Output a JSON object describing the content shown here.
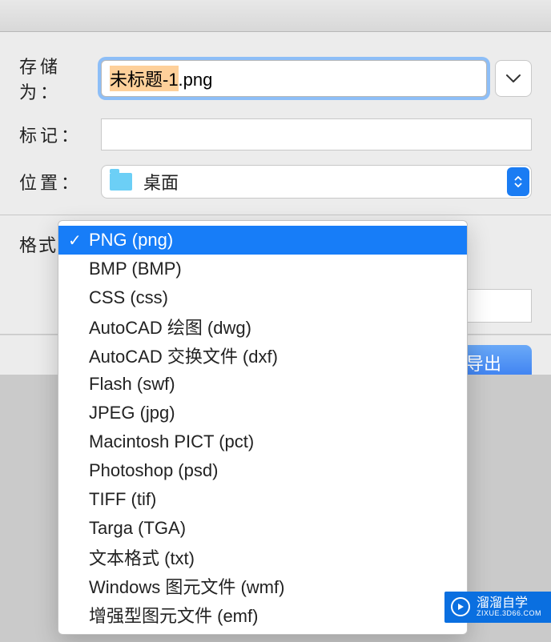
{
  "titlebar": {},
  "fields": {
    "saveas_label": "存储为：",
    "saveas_value": "未标题-1.png",
    "tags_label": "标记：",
    "tags_value": "",
    "location_label": "位置：",
    "location_value": "桌面",
    "format_label": "格式"
  },
  "format_menu": {
    "selected_index": 0,
    "items": [
      "PNG (png)",
      "BMP (BMP)",
      "CSS (css)",
      "AutoCAD 绘图 (dwg)",
      "AutoCAD 交换文件 (dxf)",
      "Flash (swf)",
      "JPEG (jpg)",
      "Macintosh PICT (pct)",
      "Photoshop (psd)",
      "TIFF (tif)",
      "Targa (TGA)",
      "文本格式 (txt)",
      "Windows 图元文件 (wmf)",
      "增强型图元文件 (emf)"
    ]
  },
  "buttons": {
    "export": "导出"
  },
  "watermark": {
    "title": "溜溜自学",
    "sub": "ZIXUE.3D66.COM"
  }
}
